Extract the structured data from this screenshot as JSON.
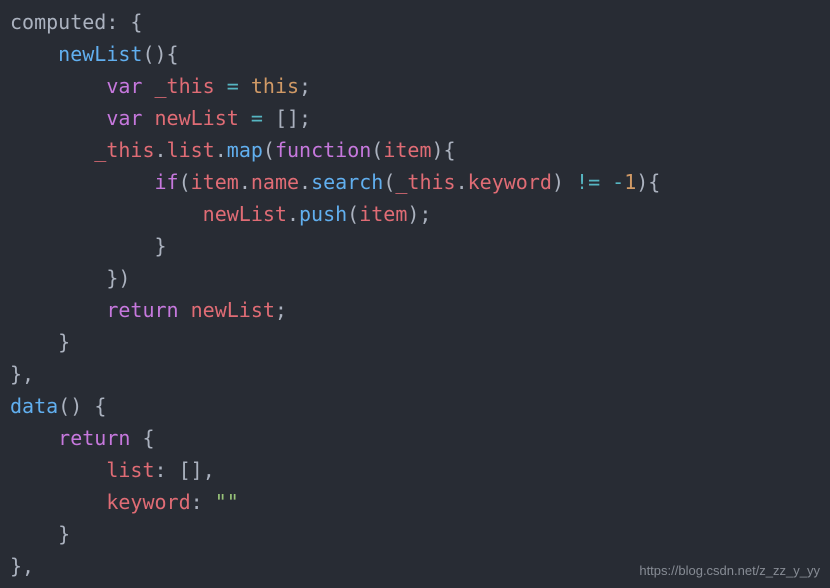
{
  "watermark": "https://blog.csdn.net/z_zz_y_yy",
  "code": {
    "computed_label": "computed",
    "method_newList": "newList",
    "kw_var": "var",
    "id_this_underscore": "_this",
    "op_assign": "=",
    "kw_this": "this",
    "id_newList": "newList",
    "lit_emptyArray_open": "[",
    "lit_emptyArray_close": "]",
    "prop_list": "list",
    "fn_map": "map",
    "kw_function": "function",
    "param_item": "item",
    "kw_if": "if",
    "prop_name": "name",
    "fn_search": "search",
    "prop_keyword": "keyword",
    "op_neq": "!=",
    "op_minus": "-",
    "num_one": "1",
    "fn_push": "push",
    "kw_return": "return",
    "method_data": "data",
    "prop_list_key": "list",
    "prop_keyword_key": "keyword",
    "lit_emptyString": "\"\""
  }
}
